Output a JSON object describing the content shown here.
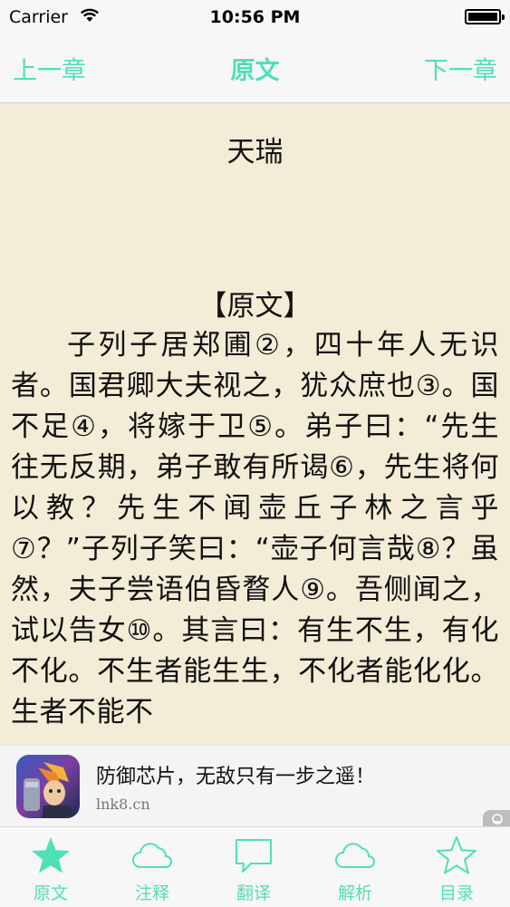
{
  "status_bar": {
    "carrier": "Carrier",
    "time": "10:56 PM",
    "wifi_icon": "wifi-icon",
    "battery_icon": "battery-icon"
  },
  "nav": {
    "prev_label": "上一章",
    "title": "原文",
    "next_label": "下一章"
  },
  "content": {
    "chapter_title": "天瑞",
    "section_label": "【原文】",
    "body": "子列子居郑圃②，四十年人无识者。国君卿大夫视之，犹众庶也③。国不足④，将嫁于卫⑤。弟子曰：“先生往无反期，弟子敢有所谒⑥，先生将何以教？先生不闻壶丘子林之言乎⑦？”子列子笑曰：“壶子何言哉⑧？虽然，夫子尝语伯昏瞀人⑨。吾侧闻之，试以告女⑩。其言曰：有生不生，有化不化。不生者能生生，不化者能化化。生者不能不"
  },
  "ad": {
    "title": "防御芯片，无敌只有一步之遥！",
    "url": "lnk8.cn"
  },
  "tabs": [
    {
      "label": "原文",
      "icon": "star-filled-icon",
      "active": true
    },
    {
      "label": "注释",
      "icon": "cloud-icon",
      "active": false
    },
    {
      "label": "翻译",
      "icon": "speech-bubble-icon",
      "active": false
    },
    {
      "label": "解析",
      "icon": "cloud-icon",
      "active": false
    },
    {
      "label": "目录",
      "icon": "star-outline-icon",
      "active": false
    }
  ],
  "colors": {
    "accent": "#4fe0b6",
    "paper": "#f3ecd6",
    "bar": "#f7f7f7"
  }
}
